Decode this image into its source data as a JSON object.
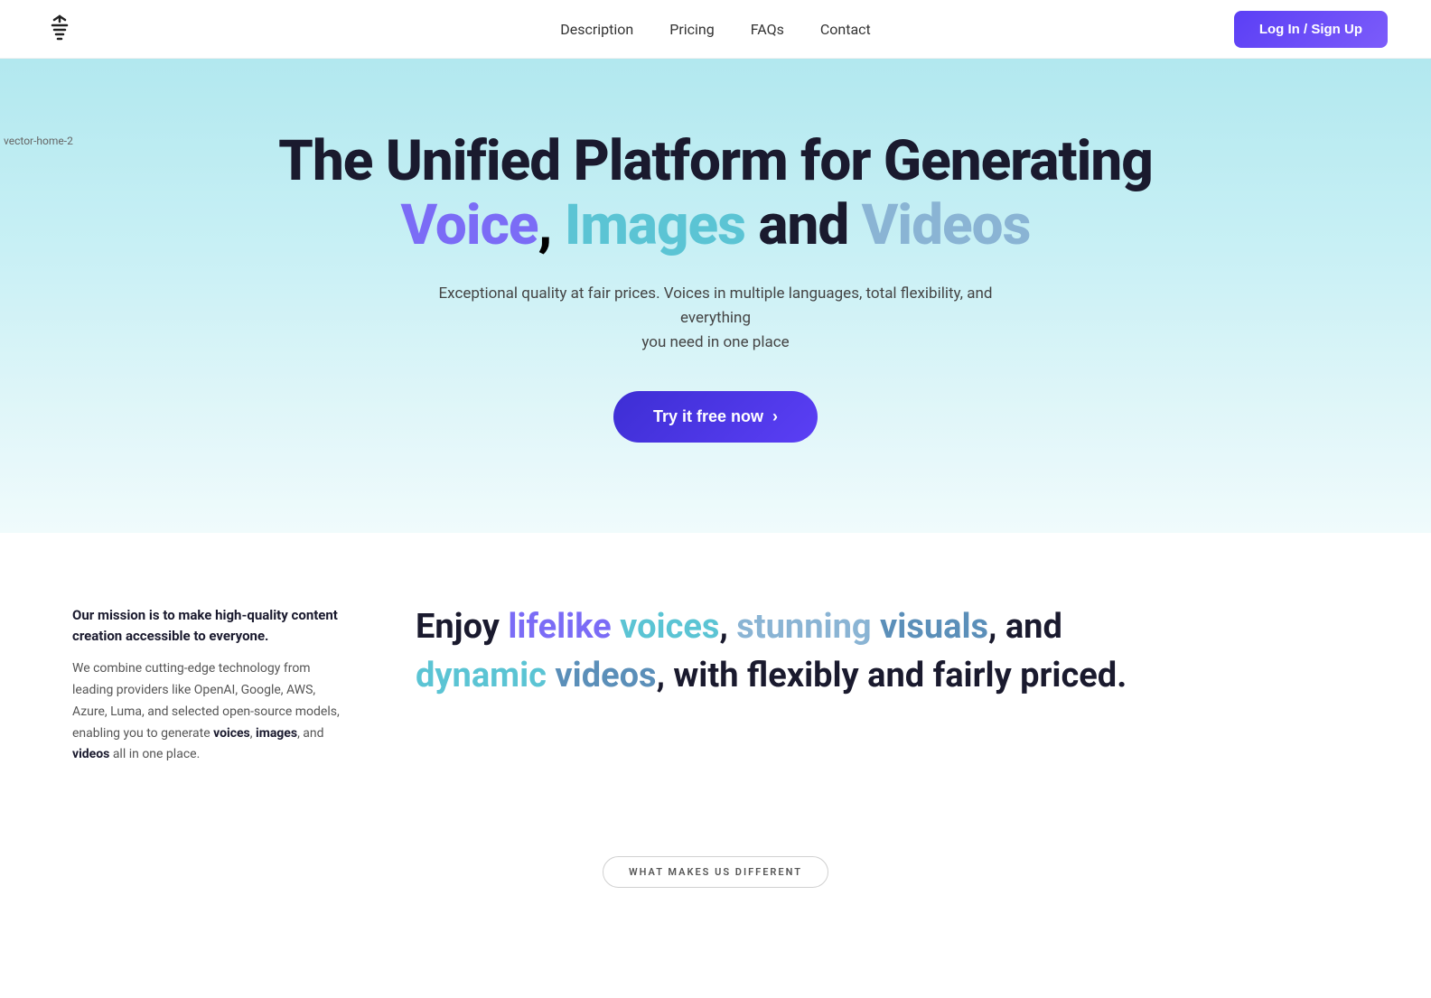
{
  "navbar": {
    "logo_alt": "Wavify Logo",
    "links": [
      {
        "label": "Description",
        "id": "nav-description"
      },
      {
        "label": "Pricing",
        "id": "nav-pricing"
      },
      {
        "label": "FAQs",
        "id": "nav-faqs"
      },
      {
        "label": "Contact",
        "id": "nav-contact"
      }
    ],
    "cta_label": "Log In / Sign Up"
  },
  "hero": {
    "bg_label": "vector-home-2",
    "title_line1": "The Unified Platform for Generating",
    "title_voice": "Voice",
    "title_comma": ",",
    "title_images": "Images",
    "title_and": " and ",
    "title_videos": "Videos",
    "subtitle_line1": "Exceptional quality at fair prices. Voices in multiple languages, total flexibility, and everything",
    "subtitle_line2": "you need in one place",
    "cta_label": "Try it free now",
    "cta_arrow": "›"
  },
  "mission": {
    "headline": "Our mission is to make high-quality content creation accessible to everyone.",
    "body1": "We combine cutting-edge technology from leading providers like OpenAI, Google, AWS, Azure, Luma, and selected open-source models, enabling you to generate ",
    "bold1": "voices",
    "body2": ", ",
    "bold2": "images",
    "body3": ", and ",
    "bold3": "videos",
    "body4": " all in one place."
  },
  "enjoy": {
    "prefix": "Enjoy ",
    "lifelike": "lifelike",
    "voices": "voices",
    "comma1": ",",
    "stunning": "stunning",
    "visuals": "visuals",
    "and_rest": ", and",
    "dynamic": "dynamic",
    "videos": "videos",
    "suffix": ", with flexibly and fairly priced."
  },
  "wmud": {
    "label": "WHAT MAKES US DIFFERENT"
  }
}
